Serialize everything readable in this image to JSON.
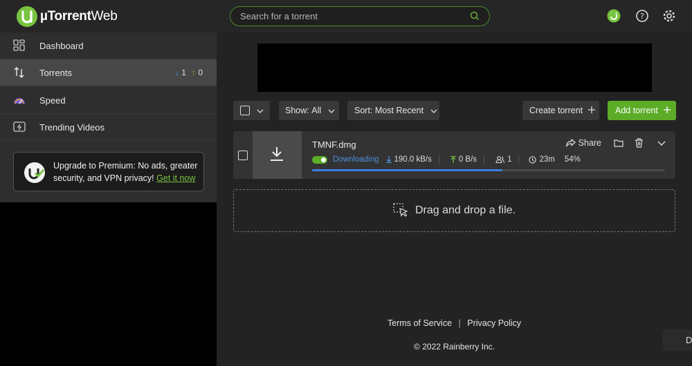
{
  "app": {
    "logo_name": "µTorrent",
    "logo_suffix": "Web"
  },
  "search": {
    "placeholder": "Search for a torrent"
  },
  "header_icons": [
    "remote-icon",
    "help-icon",
    "gear-icon"
  ],
  "sidebar": {
    "items": [
      {
        "label": "Dashboard",
        "icon": "dashboard-icon"
      },
      {
        "label": "Torrents",
        "icon": "transfer-arrows-icon",
        "down_count": "1",
        "up_count": "0"
      },
      {
        "label": "Speed",
        "icon": "speedometer-icon"
      },
      {
        "label": "Trending Videos",
        "icon": "video-icon"
      }
    ],
    "promo": {
      "text": "Upgrade to Premium: No ads, greater security, and VPN privacy!",
      "link": "Get it now"
    }
  },
  "toolbar": {
    "show_label": "Show:",
    "show_value": "All",
    "sort_label": "Sort:",
    "sort_value": "Most Recent",
    "create_label": "Create torrent",
    "add_label": "Add torrent"
  },
  "torrent": {
    "name": "TMNF.dmg",
    "status": "Downloading",
    "download_speed": "190.0 kB/s",
    "upload_speed": "0 B/s",
    "peers": "1",
    "eta": "23m",
    "percent": "54%",
    "progress": 0.54,
    "share_label": "Share"
  },
  "dropzone": {
    "text": "Drag and drop a file."
  },
  "footer": {
    "terms": "Terms of Service",
    "separator": "|",
    "privacy": "Privacy Policy",
    "copyright": "© 2022 Rainberry Inc."
  },
  "corner_button": {
    "label": "D"
  },
  "colors": {
    "accent_green": "#5cac28",
    "download_blue": "#4d8fdc",
    "progress_blue": "#3a7ee0"
  }
}
